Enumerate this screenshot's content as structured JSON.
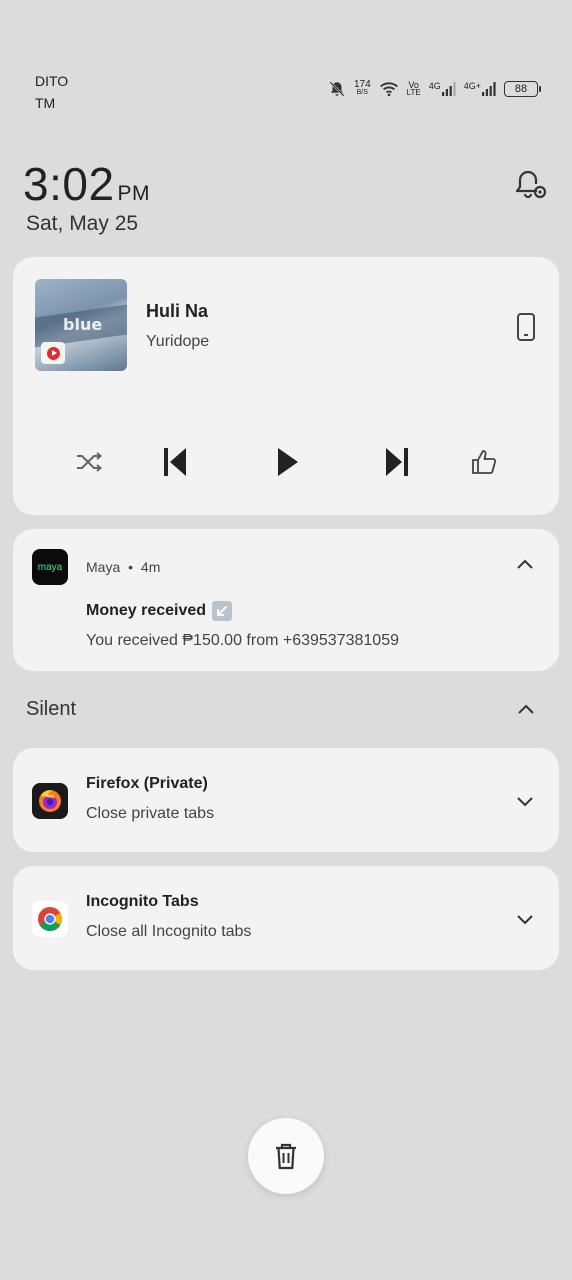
{
  "status_bar": {
    "carrier_line1": "DITO",
    "carrier_line2": "TM",
    "net_speed_value": "174",
    "net_speed_unit": "B/S",
    "volte_top": "Vo",
    "volte_bottom": "LTE",
    "sim1_type": "4G",
    "sim2_type": "4G+",
    "battery": "88",
    "icons": [
      "bell-off-icon",
      "wifi-icon",
      "signal-icon",
      "signal-icon",
      "battery-icon"
    ]
  },
  "clock": {
    "time": "3:02",
    "ampm": "PM",
    "date": "Sat, May 25"
  },
  "media": {
    "title": "Huli Na",
    "artist": "Yuridope",
    "album_word": "blue",
    "controls": [
      "shuffle-icon",
      "previous-icon",
      "play-icon",
      "next-icon",
      "thumbs-up-icon"
    ]
  },
  "notifications": {
    "maya": {
      "app": "Maya",
      "time": "4m",
      "logo": "maya",
      "title": "Money received",
      "text": "You received ₱150.00 from +639537381059"
    },
    "silent_header": "Silent",
    "firefox": {
      "title": "Firefox (Private)",
      "text": "Close private tabs"
    },
    "incognito": {
      "title": "Incognito Tabs",
      "text": "Close all Incognito tabs"
    }
  },
  "colors": {
    "background": "#dcdcdc",
    "card": "#f3f3f3",
    "maya_green": "#3ce89b"
  }
}
